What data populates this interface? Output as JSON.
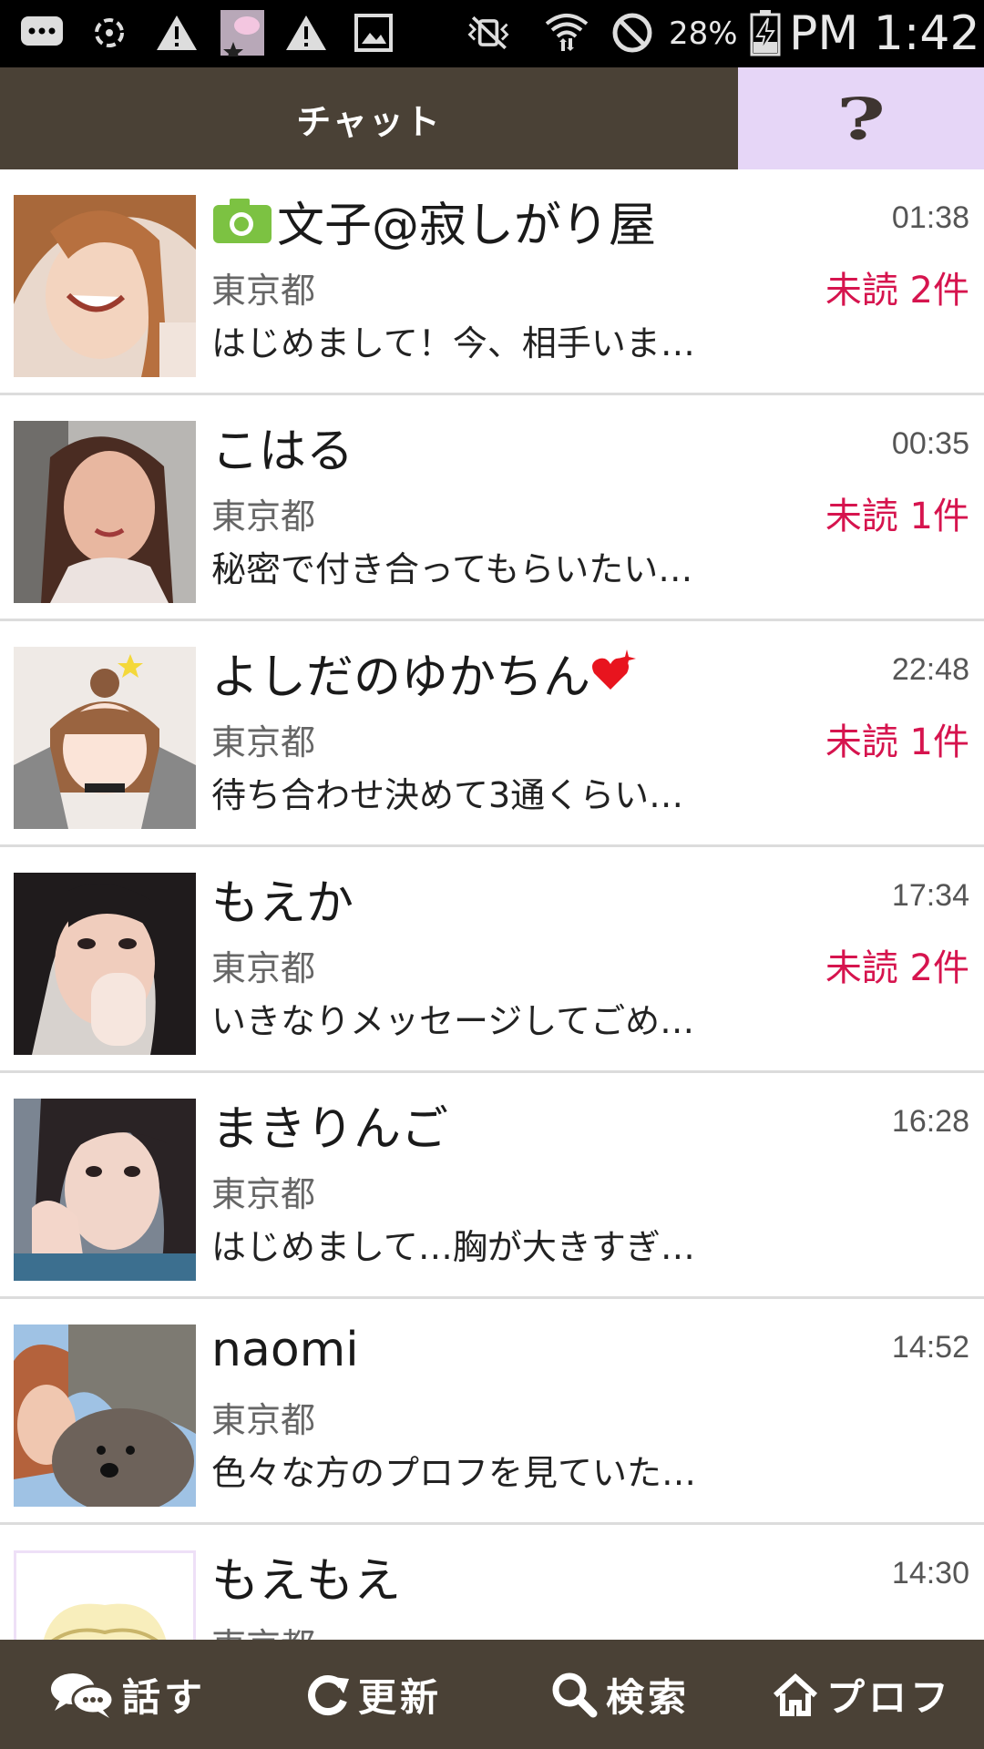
{
  "status_bar": {
    "battery": "28%",
    "clock": "PM 1:42"
  },
  "header": {
    "title": "チャット",
    "help_label": "?"
  },
  "chats": [
    {
      "name": "文子@寂しがり屋",
      "time": "01:38",
      "location": "東京都",
      "unread": "未読 2件",
      "preview": "はじめまして！今、相手いま…"
    },
    {
      "name": "こはる",
      "time": "00:35",
      "location": "東京都",
      "unread": "未読 1件",
      "preview": "秘密で付き合ってもらいたい…"
    },
    {
      "name": "よしだのゆかちん",
      "time": "22:48",
      "location": "東京都",
      "unread": "未読 1件",
      "preview": "待ち合わせ決めて3通くらい…"
    },
    {
      "name": "もえか",
      "time": "17:34",
      "location": "東京都",
      "unread": "未読 2件",
      "preview": "いきなりメッセージしてごめ…"
    },
    {
      "name": "まきりんご",
      "time": "16:28",
      "location": "東京都",
      "unread": "",
      "preview": "はじめまして…胸が大きすぎ…"
    },
    {
      "name": "naomi",
      "time": "14:52",
      "location": "東京都",
      "unread": "",
      "preview": "色々な方のプロフを見ていた…"
    },
    {
      "name": "もえもえ",
      "time": "14:30",
      "location": "東京都",
      "unread": "",
      "preview": ""
    }
  ],
  "bottom_nav": {
    "talk": "話す",
    "refresh": "更新",
    "search": "検索",
    "profile": "プロフ"
  },
  "colors": {
    "header_bg": "#4a4136",
    "help_bg": "#e6d6f7",
    "unread": "#d6144e",
    "camera_icon": "#7cc242",
    "heart_icon": "#e8141e"
  }
}
